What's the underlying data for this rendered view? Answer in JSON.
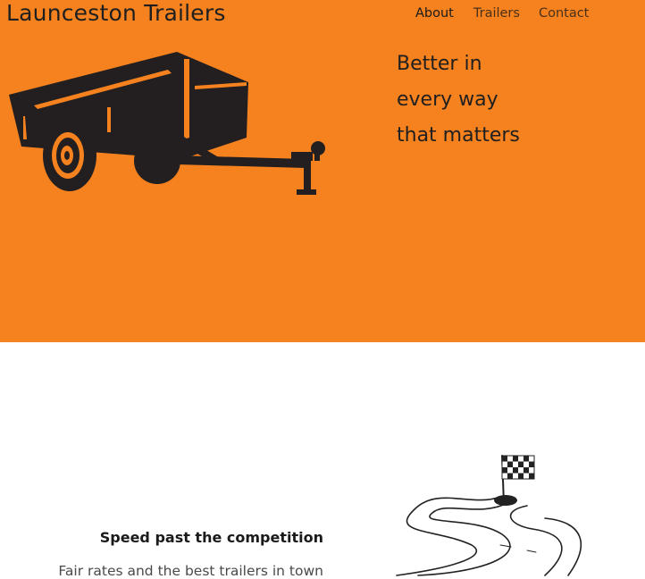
{
  "header": {
    "site_title": "Launceston Trailers",
    "nav": [
      {
        "label": "About",
        "active": true
      },
      {
        "label": "Trailers",
        "active": false
      },
      {
        "label": "Contact",
        "active": false
      }
    ]
  },
  "hero": {
    "tagline": [
      "Better in",
      "every way",
      "that matters"
    ],
    "image_icon": "trailer-illustration"
  },
  "feature": {
    "title": "Speed past the competition",
    "text": "Fair rates and the best trailers in town",
    "image_icon": "race-track-flag-illustration"
  },
  "colors": {
    "hero_background": "#f5821f",
    "text_dark": "#1f1f1f",
    "page_background": "#ffffff"
  }
}
